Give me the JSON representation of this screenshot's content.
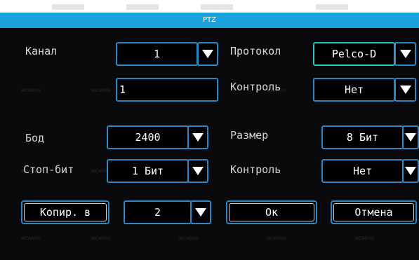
{
  "dialog": {
    "title": "PTZ"
  },
  "fields": {
    "channel": {
      "label": "Канал",
      "value": "1",
      "address": "1"
    },
    "protocol": {
      "label": "Протокол",
      "value": "Pelco-D"
    },
    "control1": {
      "label": "Контроль",
      "value": "Нет"
    },
    "baud": {
      "label": "Бод",
      "value": "2400"
    },
    "size": {
      "label": "Размер",
      "value": "8 Бит"
    },
    "stopbit": {
      "label": "Стоп-бит",
      "value": "1 Бит"
    },
    "control2": {
      "label": "Контроль",
      "value": "Нет"
    }
  },
  "actions": {
    "copy_to_label": "Копир. в",
    "copy_target": "2",
    "ok_label": "Ок",
    "cancel_label": "Отмена"
  },
  "colors": {
    "title_bar": "#1aa3dd",
    "border": "#2a87c8",
    "focus_border": "#29c3c0",
    "background": "#0a0a0c"
  }
}
